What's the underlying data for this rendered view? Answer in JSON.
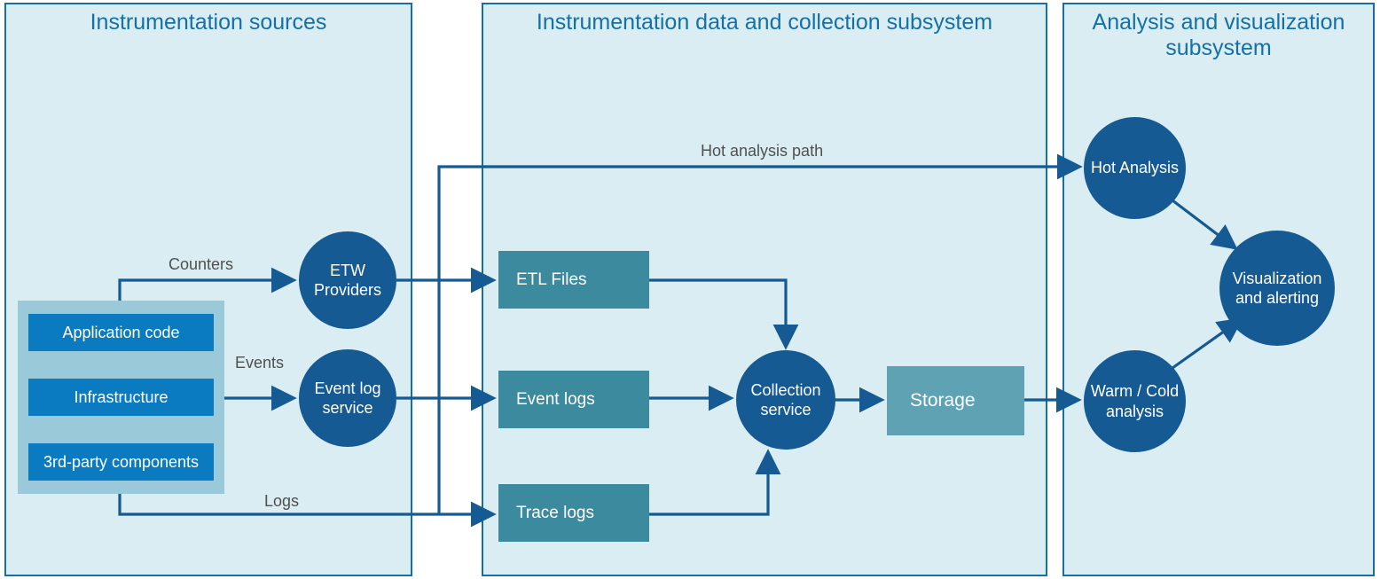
{
  "subsystems": {
    "sources": {
      "title": "Instrumentation sources"
    },
    "collection": {
      "title": "Instrumentation data and collection subsystem"
    },
    "analysis": {
      "title": "Analysis and visualization subsystem"
    }
  },
  "sourceItems": {
    "app": "Application code",
    "infra": "Infrastructure",
    "third": "3rd-party components"
  },
  "providers": {
    "etw": "ETW Providers",
    "eventLog": "Event log service"
  },
  "files": {
    "etl": "ETL Files",
    "eventLogs": "Event logs",
    "traceLogs": "Trace logs"
  },
  "collection_nodes": {
    "collectionService": "Collection service",
    "storage": "Storage"
  },
  "analysis_nodes": {
    "hot": "Hot Analysis",
    "warm": "Warm / Cold analysis",
    "viz": "Visualization and alerting"
  },
  "edgeLabels": {
    "counters": "Counters",
    "events": "Events",
    "logs": "Logs",
    "hotPath": "Hot analysis path"
  }
}
